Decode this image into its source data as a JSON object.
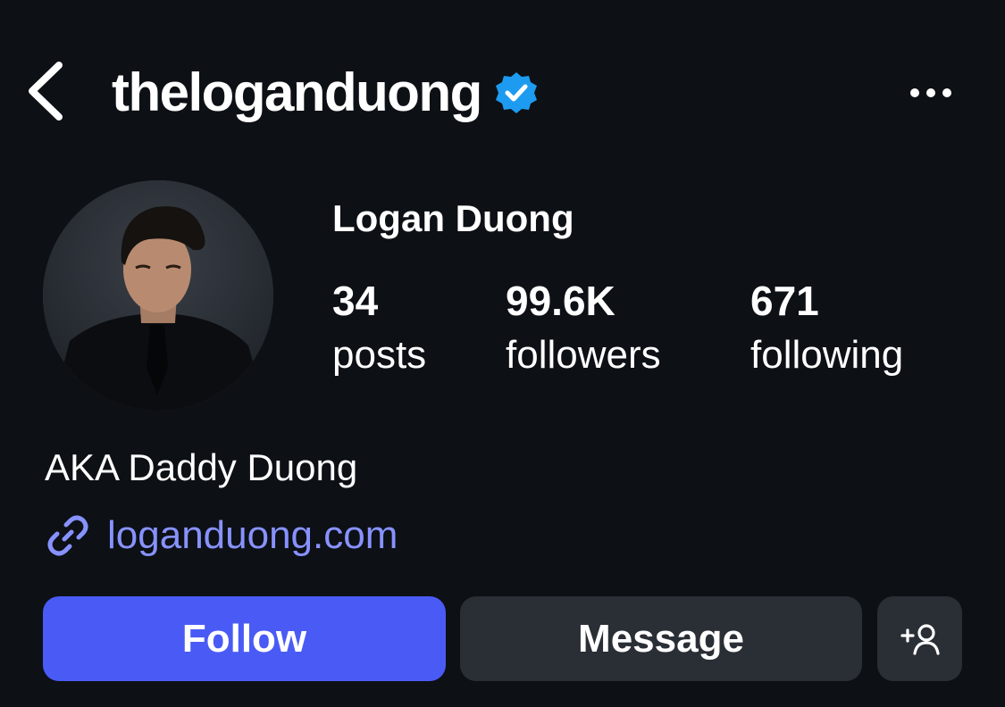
{
  "header": {
    "username": "theloganduong",
    "verified": true,
    "back_icon": "chevron-left-icon",
    "more_icon": "more-horizontal-icon"
  },
  "profile": {
    "display_name": "Logan Duong",
    "stats": {
      "posts": {
        "value": "34",
        "label": "posts"
      },
      "followers": {
        "value": "99.6K",
        "label": "followers"
      },
      "following": {
        "value": "671",
        "label": "following"
      }
    },
    "bio": "AKA Daddy Duong",
    "link": "loganduong.com"
  },
  "actions": {
    "follow_label": "Follow",
    "message_label": "Message",
    "suggest_icon": "add-person-icon"
  },
  "colors": {
    "background": "#0d1015",
    "primary_button": "#4a5bf5",
    "secondary_button": "#2a2e35",
    "link": "#8792ff",
    "verified_badge": "#1d9bf0"
  }
}
